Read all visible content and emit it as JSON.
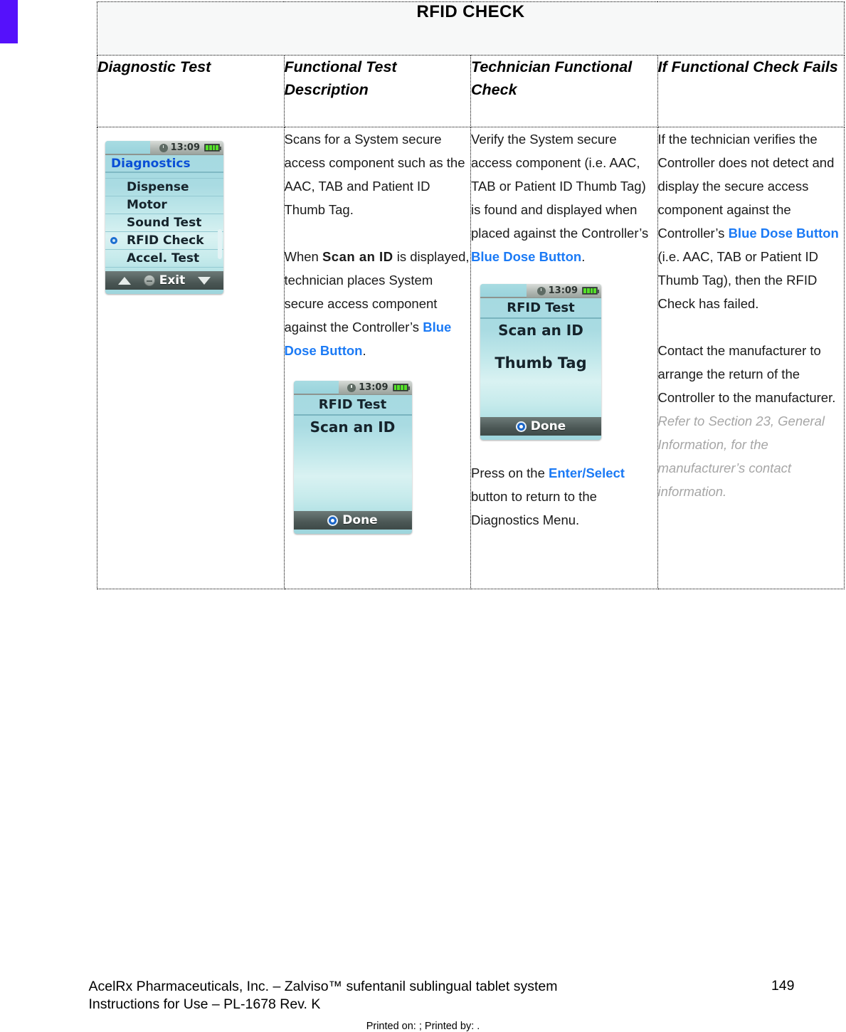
{
  "page": {
    "title": "RFID CHECK",
    "corner_mark_color": "#5511fb"
  },
  "table": {
    "headers": [
      "Diagnostic Test",
      "Functional Test Description",
      "Technician Functional Check",
      "If Functional Check Fails"
    ],
    "col2": {
      "para1": "Scans for a System secure access component such as the AAC, TAB and Patient ID Thumb Tag.",
      "para2_a": "When ",
      "para2_b": "Scan an ID",
      "para2_c": " is displayed, technician places System secure access component against the Controller’s ",
      "para2_blue": "Blue Dose Button",
      "para2_end": "."
    },
    "col3": {
      "para1_a": "Verify the System secure access component (i.e. AAC, TAB or Patient ID Thumb Tag) is found and displayed when placed against the Controller’s ",
      "para1_blue": "Blue Dose Button",
      "para1_end": ".",
      "para2_a": "Press on the ",
      "para2_blue": "Enter/Select",
      "para2_b": " button to return to the Diagnostics Menu."
    },
    "col4": {
      "para1_a": "If the technician verifies the Controller does not detect and display the secure access component against the Controller’s ",
      "para1_blue": "Blue Dose Button",
      "para1_b": " (i.e. AAC, TAB or Patient ID Thumb Tag), then the RFID Check has failed.",
      "para2_a": "Contact the manufacturer to arrange the return of the Controller to the manufacturer.  ",
      "para2_italic": "Refer to Section 23, General Information, for the manufacturer’s contact information."
    }
  },
  "devices": {
    "diagnostics": {
      "time": "13:09",
      "title": "Diagnostics",
      "items": [
        "Dispense",
        "Motor",
        "Sound Test",
        "RFID Check",
        "Accel. Test"
      ],
      "selected_index": 3,
      "footer_label": "Exit"
    },
    "rfid_scan": {
      "time": "13:09",
      "title": "RFID Test",
      "line1": "Scan an ID",
      "line2": "",
      "footer_label": "Done"
    },
    "rfid_thumbtag": {
      "time": "13:09",
      "title": "RFID Test",
      "line1": "Scan an ID",
      "line2": "Thumb Tag",
      "footer_label": "Done"
    }
  },
  "footer": {
    "line1": "AcelRx Pharmaceuticals, Inc. – Zalviso™ sufentanil sublingual tablet system",
    "line2": "Instructions for Use – PL-1678 Rev. K",
    "page_number": "149",
    "printed": "Printed on: ; Printed by: ."
  }
}
